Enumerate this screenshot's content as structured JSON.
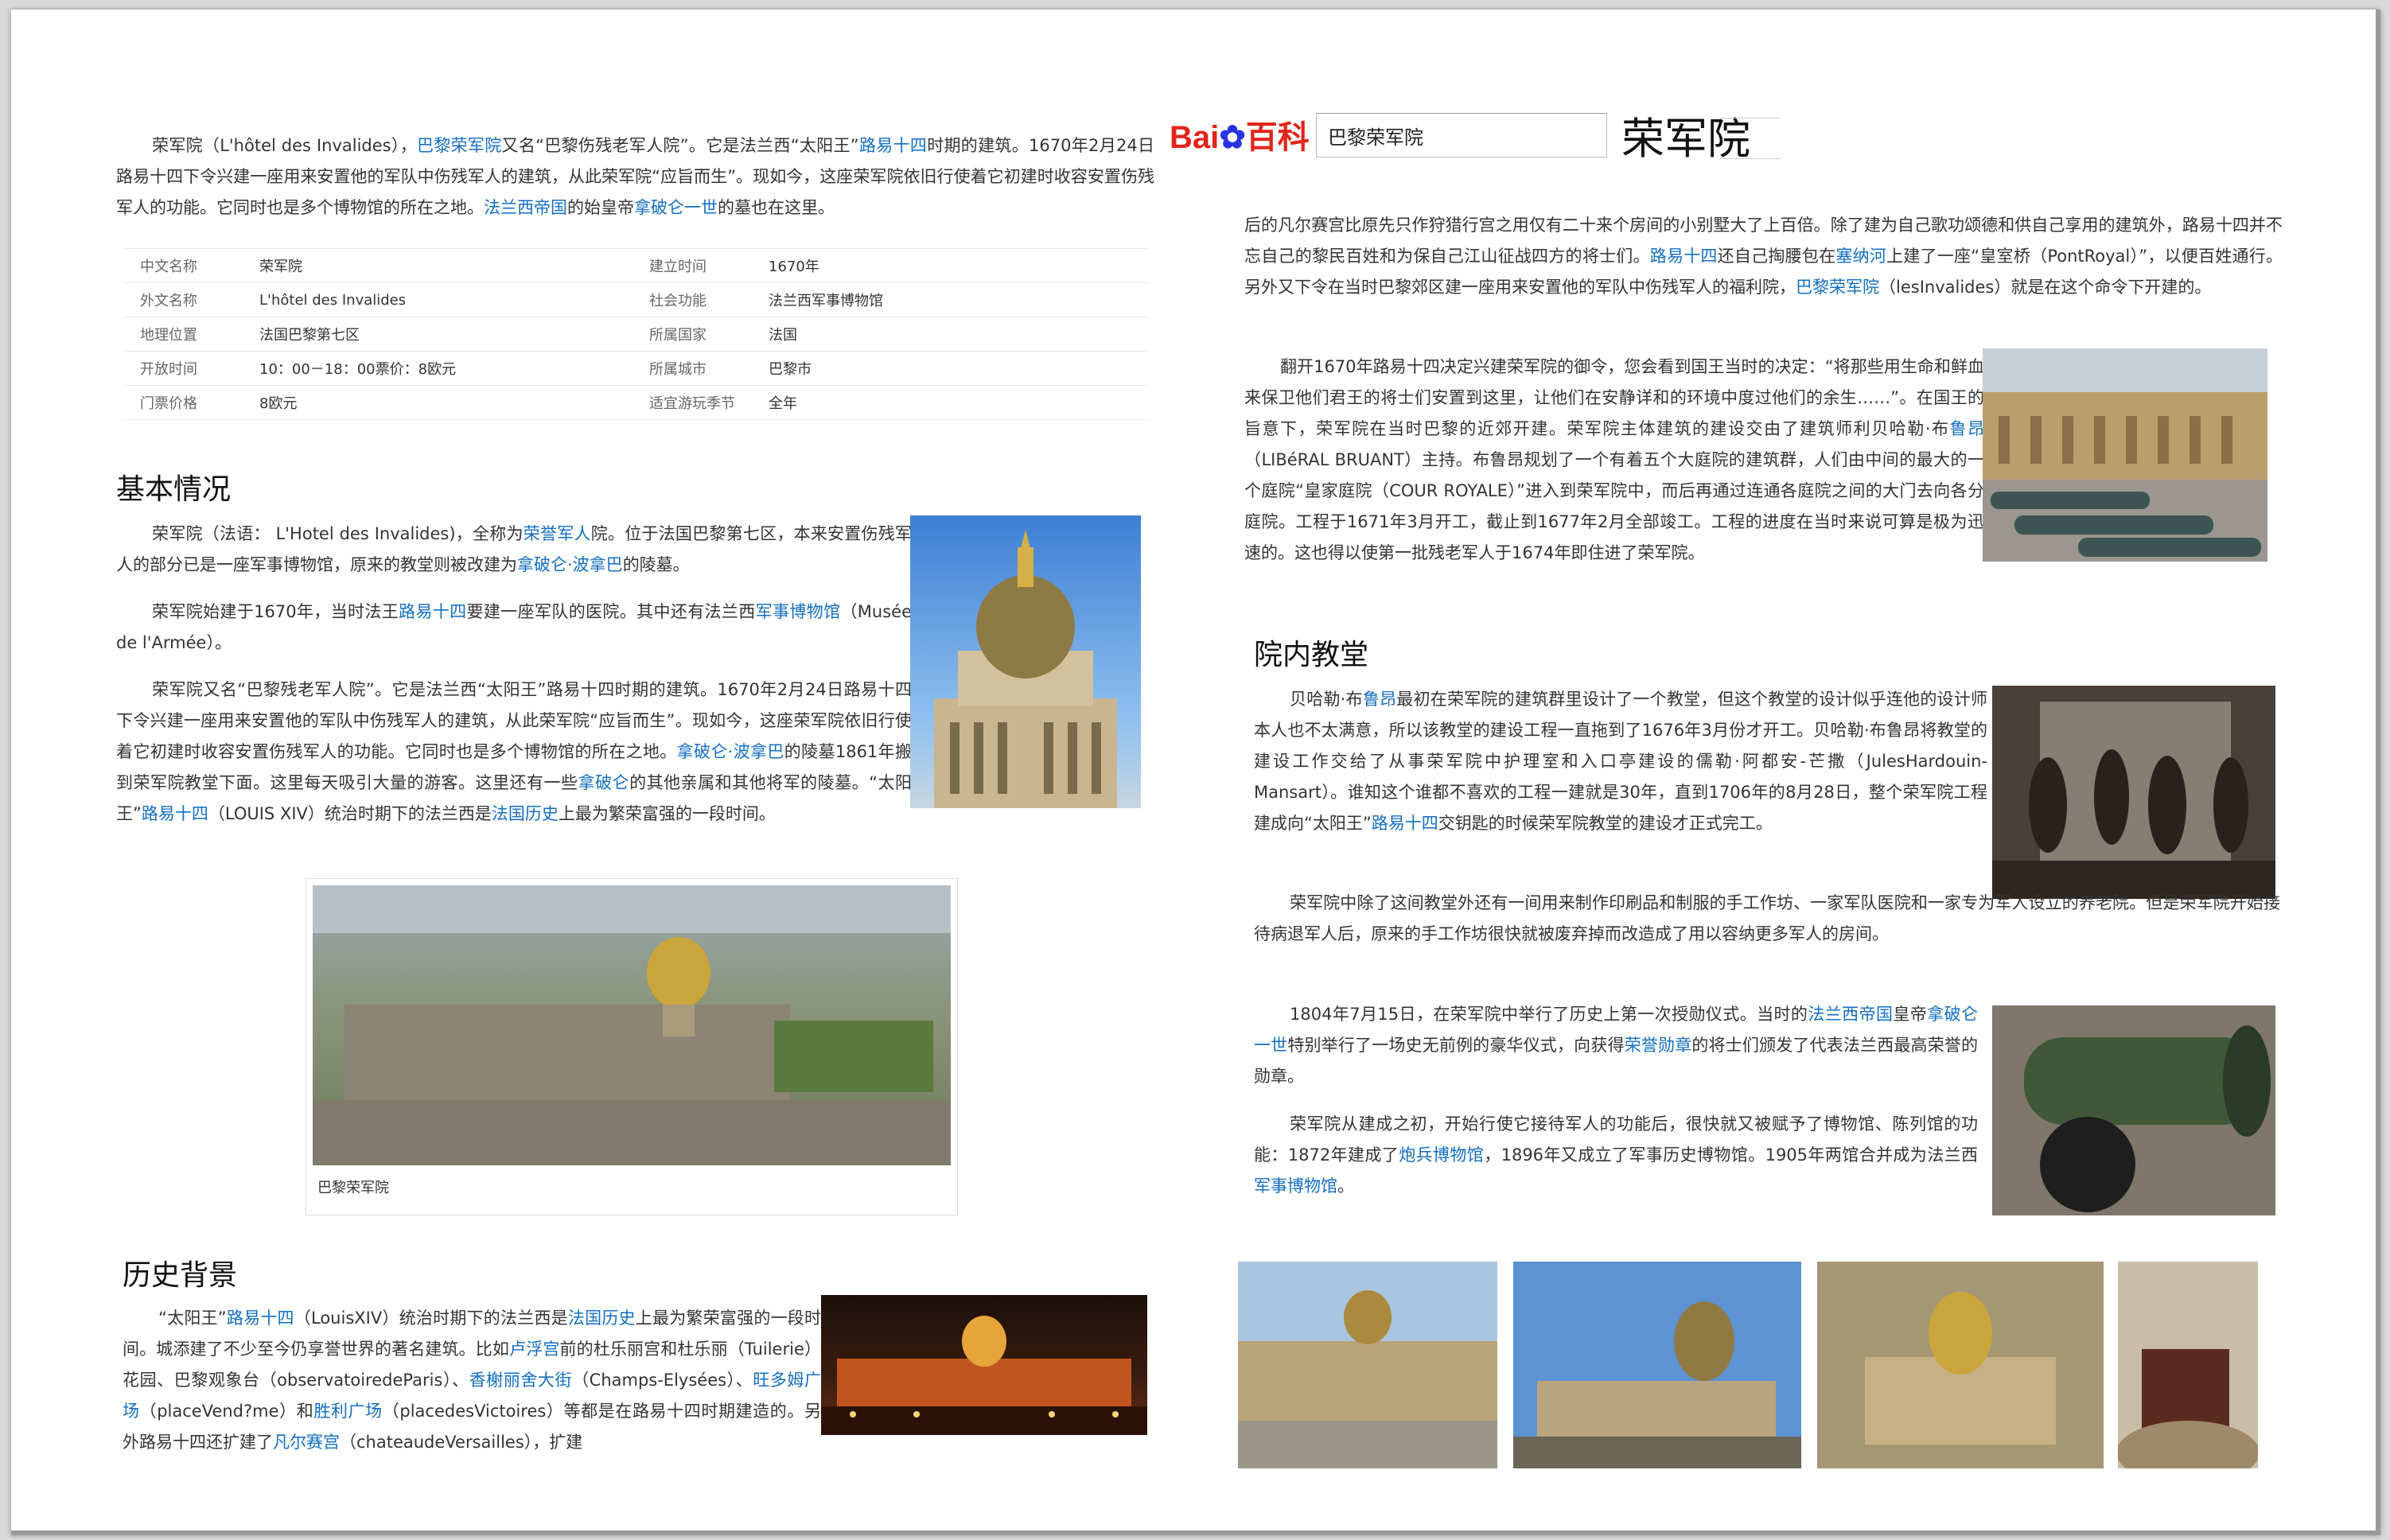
{
  "header": {
    "logo_left": "Bai",
    "logo_mid": "du",
    "logo_right": "百科",
    "search_value": "巴黎荣军院",
    "entry_title": "荣军院"
  },
  "intro": {
    "p1": "荣军院（L'hôtel des Invalides），",
    "link1": "巴黎荣军院",
    "p2": "又名“巴黎伤残老军人院”。它是法兰西“太阳王”",
    "link2": "路易十四",
    "p3": "时期的建筑。1670年2月24日路易十四下令兴建一座用来安置他的军队中伤残军人的建筑，从此荣军院“应旨而生”。现如今，这座荣军院依旧行使着它初建时收容安置伤残军人的功能。它同时也是多个博物馆的所在之地。",
    "link3": "法兰西帝国",
    "p4": "的始皇帝",
    "link4": "拿破仑一世",
    "p5": "的墓也在这里。"
  },
  "infobox": [
    {
      "k1": "中文名称",
      "v1": "荣军院",
      "k2": "建立时间",
      "v2": "1670年"
    },
    {
      "k1": "外文名称",
      "v1": "L'hôtel des Invalides",
      "k2": "社会功能",
      "v2": "法兰西军事博物馆"
    },
    {
      "k1": "地理位置",
      "v1": "法国巴黎第七区",
      "k2": "所属国家",
      "v2": "法国"
    },
    {
      "k1": "开放时间",
      "v1": "10：00－18：00票价：8欧元",
      "k2": "所属城市",
      "v2": "巴黎市"
    },
    {
      "k1": "门票价格",
      "v1": "8欧元",
      "k2": "适宜游玩季节",
      "v2": "全年"
    }
  ],
  "basic": {
    "title": "基本情况",
    "a1": "荣军院（法语： L'Hotel des Invalides)，全称为",
    "a_link1": "荣誉军人",
    "a2": "院。位于法国巴黎第七区，本来安置伤残军人的部分已是一座军事博物馆，原来的教堂则被改建为",
    "a_link2": "拿破仑·波拿巴",
    "a3": "的陵墓。",
    "b1": "荣军院始建于1670年，当时法王",
    "b_link1": "路易十四",
    "b2": "要建一座军队的医院。其中还有法兰西",
    "b_link2": "军事博物馆",
    "b3": "（Musée de l'Armée）。",
    "c1": "荣军院又名“巴黎残老军人院”。它是法兰西“太阳王”路易十四时期的建筑。1670年2月24日路易十四下令兴建一座用来安置他的军队中伤残军人的建筑，从此荣军院“应旨而生”。现如今，这座荣军院依旧行使着它初建时收容安置伤残军人的功能。它同时也是多个博物馆的所在之地。",
    "c_link1": "拿破仑·波拿巴",
    "c2": "的陵墓1861年搬到荣军院教堂下面。这里每天吸引大量的游客。这里还有一些",
    "c_link2": "拿破仑",
    "c3": "的其他亲属和其他将军的陵墓。“太阳王”",
    "c_link3": "路易十四",
    "c4": "（LOUIS XIV）统治时期下的法兰西是",
    "c_link4": "法国历史",
    "c5": "上最为繁荣富强的一段时间。",
    "photo_caption": "巴黎荣军院"
  },
  "history": {
    "title": "历史背景",
    "t1": "“太阳王”",
    "l1": "路易十四",
    "t2": "（LouisXIV）统治时期下的法兰西是",
    "l2": "法国历史",
    "t3": "上最为繁荣富强的一段时间。城添建了不少至今仍享誉世界的著名建筑。比如",
    "l3": "卢浮宫",
    "t4": "前的杜乐丽宫和杜乐丽（Tuilerie）花园、巴黎观象台（observatoiredeParis）、",
    "l4": "香榭丽舍大街",
    "t5": "（Champs-Elysées）、",
    "l5": "旺多姆广场",
    "t6": "（placeVend?me）和",
    "l6": "胜利广场",
    "t7": "（placedesVictoires）等都是在路易十四时期建造的。另外路易十四还扩建了",
    "l7": "凡尔赛宫",
    "t8": "（chateaudeVersailles），扩建"
  },
  "right_cont": {
    "r1": "后的凡尔赛宫比原先只作狩猎行宫之用仅有二十来个房间的小别墅大了上百倍。除了建为自己歌功颂德和供自己享用的建筑外，路易十四并不忘自己的黎民百姓和为保自己江山征战四方的将士们。",
    "rl1": "路易十四",
    "r2": "还自己掏腰包在",
    "rl2": "塞纳河",
    "r3": "上建了一座“皇室桥（PontRoyal）”，以便百姓通行。另外又下令在当时巴黎郊区建一座用来安置他的军队中伤残军人的福利院，",
    "rl3": "巴黎荣军院",
    "r4": "（lesInvalides）就是在这个命令下开建的。",
    "s1": "翻开1670年路易十四决定兴建荣军院的御令，您会看到国王当时的决定：“将那些用生命和鲜血来保卫他们君王的将士们安置到这里，让他们在安静详和的环境中度过他们的余生……”。在国王的旨意下，荣军院在当时巴黎的近郊开建。荣军院主体建筑的建设交由了建筑师利贝哈勒·布",
    "sl1": "鲁昂",
    "s2": "（LIBéRAL BRUANT）主持。布鲁昂规划了一个有着五个大庭院的建筑群，人们由中间的最大的一个庭院“皇家庭院（COUR ROYALE）”进入到荣军院中，而后再通过连通各庭院之间的大门去向各分庭院。工程于1671年3月开工，截止到1677年2月全部竣工。工程的进度在当时来说可算是极为迅速的。这也得以使第一批残老军人于1674年即住进了荣军院。"
  },
  "chapel": {
    "title": "院内教堂",
    "a1": "贝哈勒·布",
    "al1": "鲁昂",
    "a2": "最初在荣军院的建筑群里设计了一个教堂，但这个教堂的设计似乎连他的设计师本人也不太满意，所以该教堂的建设工程一直拖到了1676年3月份才开工。贝哈勒·布鲁昂将教堂的建设工作交给了从事荣军院中护理室和入口亭建设的儒勒·阿都安-芒撒（JulesHardouin-Mansart）。谁知这个谁都不喜欢的工程一建就是30年，直到1706年的8月28日，整个荣军院工程建成向“太阳王”",
    "al2": "路易十四",
    "a3": "交钥匙的时候荣军院教堂的建设才正式完工。",
    "b1": "荣军院中除了这间教堂外还有一间用来制作印刷品和制服的手工作坊、一家军队医院和一家专为军人设立的养老院。但是荣军院开始接待病退军人后，原来的手工作坊很快就被废弃掉而改造成了用以容纳更多军人的房间。",
    "c1": "1804年7月15日，在荣军院中举行了历史上第一次授勋仪式。当时的",
    "cl1": "法兰西帝国",
    "c2": "皇帝",
    "cl2": "拿破仑一世",
    "c3": "特别举行了一场史无前例的豪华仪式，向获得",
    "cl3": "荣誉勋章",
    "c4": "的将士们颁发了代表法兰西最高荣誉的勋章。",
    "d1": "荣军院从建成之初，开始行使它接待军人的功能后，很快就又被赋予了博物馆、陈列馆的功能：1872年建成了",
    "dl1": "炮兵博物馆",
    "d2": "，1896年又成立了军事历史博物馆。1905年两馆合并成为法兰西",
    "dl2": "军事博物馆",
    "d3": "。"
  },
  "colors": {
    "link": "#136ec2",
    "logo_red": "#e1251b",
    "logo_blue": "#2932e1"
  },
  "icons": {
    "paw": "paw-icon"
  }
}
